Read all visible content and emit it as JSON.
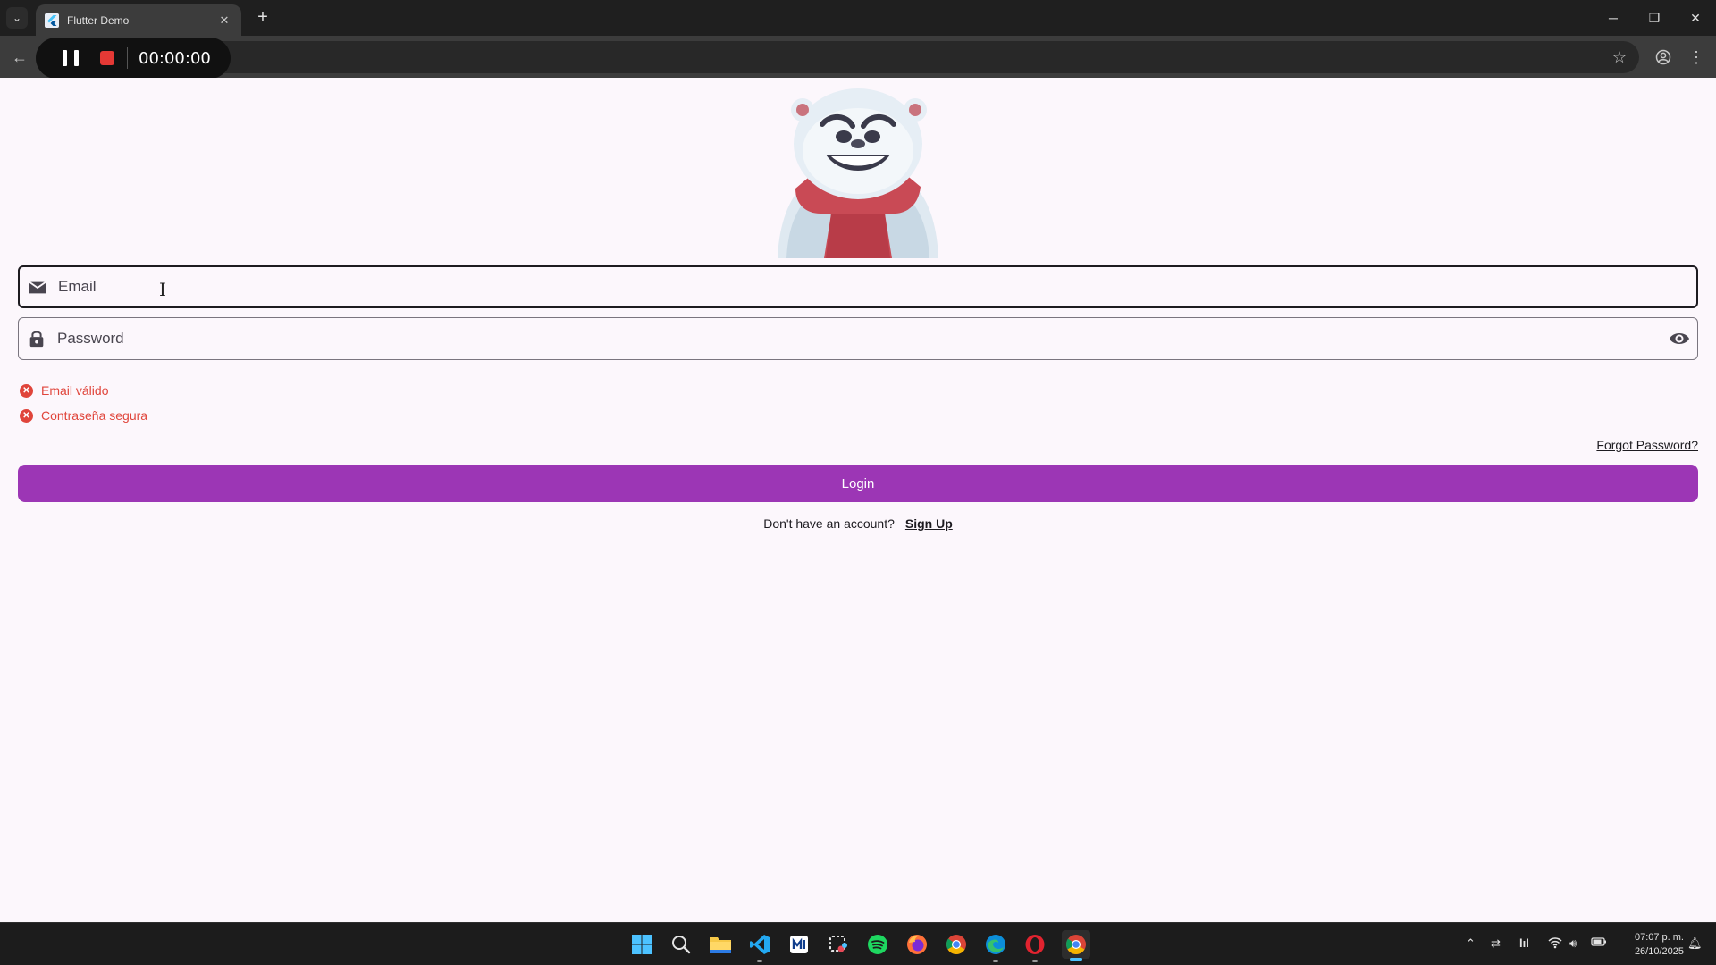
{
  "browser": {
    "tab_title": "Flutter Demo",
    "recorder_time": "00:00:00"
  },
  "form": {
    "email_placeholder": "Email",
    "password_placeholder": "Password",
    "validations": [
      {
        "label": "Email válido",
        "status": "invalid"
      },
      {
        "label": "Contraseña segura",
        "status": "invalid"
      }
    ],
    "forgot_password": "Forgot Password?",
    "login_label": "Login",
    "signup_prompt": "Don't have an account?",
    "signup_link": "Sign Up"
  },
  "colors": {
    "primary": "#9c36b5",
    "error": "#e0453b",
    "background": "#fcf7fc"
  },
  "taskbar": {
    "apps": [
      "windows-start-icon",
      "search-icon",
      "file-explorer-icon",
      "vscode-icon",
      "notes-icon",
      "snipping-tool-icon",
      "spotify-icon",
      "firefox-icon",
      "chrome-icon",
      "edge-icon",
      "opera-icon",
      "chrome-icon"
    ],
    "time": "07:07 p. m.",
    "date": "26/10/2025"
  }
}
